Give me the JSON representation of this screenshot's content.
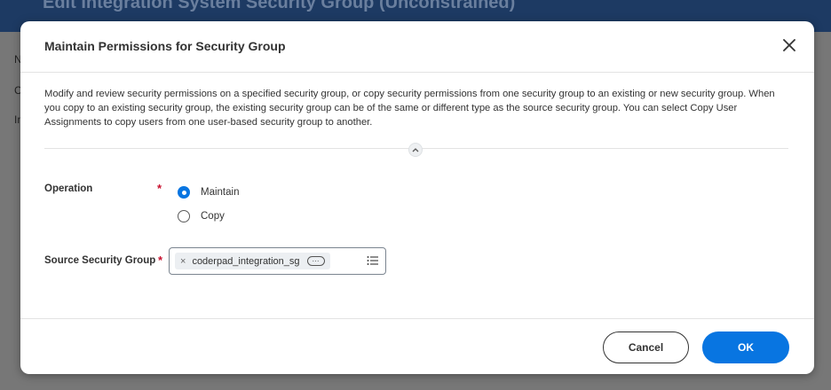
{
  "background": {
    "header_title": "Edit Integration System Security Group (Unconstrained)",
    "side_letters": [
      "N",
      "C",
      "In"
    ]
  },
  "modal": {
    "title": "Maintain Permissions for Security Group",
    "close_icon": "close-icon",
    "description": "Modify and review security permissions on a specified security group, or copy security permissions from one security group to an existing or new security group. When you copy to an existing security group, the existing security group can be of the same or different type as the source security group. You can select Copy User Assignments to copy users from one user-based security group to another.",
    "collapse_icon": "chevron-up-icon",
    "operation": {
      "label": "Operation",
      "required_mark": "*",
      "options": [
        "Maintain",
        "Copy"
      ],
      "selected": "Maintain"
    },
    "source_group": {
      "label": "Source Security Group",
      "required_mark": "*",
      "pill_remove": "×",
      "pill_value": "coderpad_integration_sg",
      "pill_more": "···",
      "list_icon": "list-icon"
    },
    "buttons": {
      "cancel": "Cancel",
      "ok": "OK"
    }
  },
  "colors": {
    "primary": "#0875e1",
    "required": "#c8102e",
    "header_bg": "#1d3a63"
  }
}
